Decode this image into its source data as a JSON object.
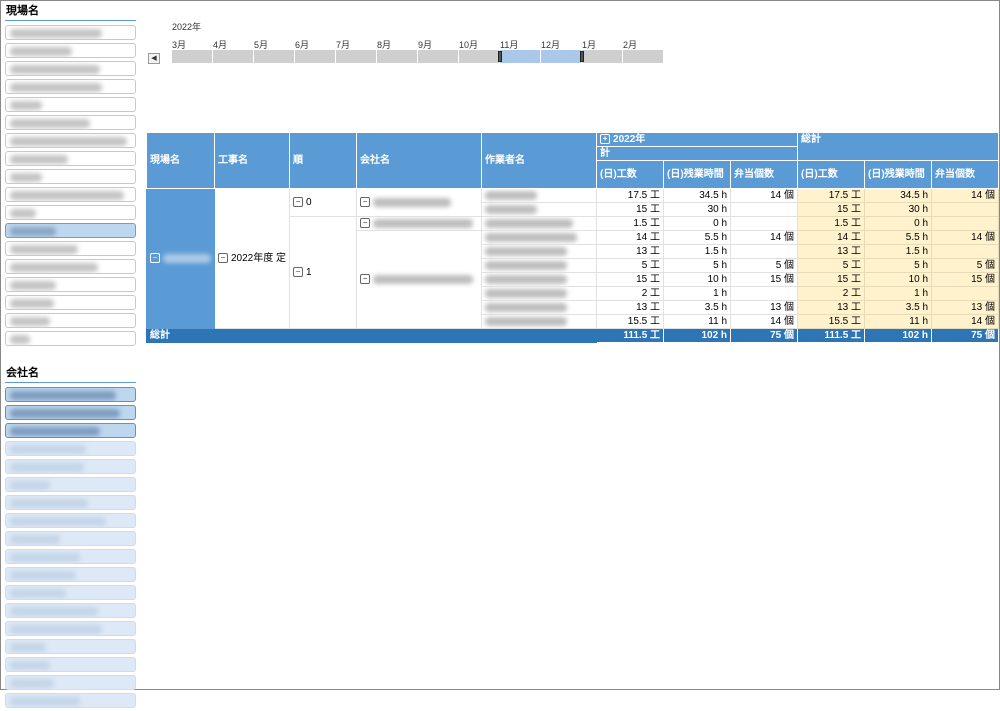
{
  "slicers": {
    "site": {
      "title": "現場名"
    },
    "company": {
      "title": "会社名"
    }
  },
  "timeline": {
    "year": "2022年",
    "months": [
      "3月",
      "4月",
      "5月",
      "6月",
      "7月",
      "8月",
      "9月",
      "10月",
      "11月",
      "12月",
      "1月",
      "2月"
    ],
    "selected_months": [
      "11月",
      "12月"
    ]
  },
  "pivot": {
    "headers": {
      "site": "現場名",
      "work": "工事名",
      "order": "順",
      "company": "会社名",
      "worker": "作業者名",
      "year": "2022年",
      "subtotal": "計",
      "grand": "総計",
      "measures": [
        "(日)工数",
        "(日)残業時間",
        "弁当個数"
      ]
    },
    "work_name": "2022年度 定",
    "groups": [
      "0",
      "1"
    ],
    "rows": [
      {
        "a": "17.5 工",
        "b": "34.5 h",
        "c": "14 個"
      },
      {
        "a": "15 工",
        "b": "30 h",
        "c": ""
      },
      {
        "a": "1.5 工",
        "b": "0 h",
        "c": ""
      },
      {
        "a": "14 工",
        "b": "5.5 h",
        "c": "14 個"
      },
      {
        "a": "13 工",
        "b": "1.5 h",
        "c": ""
      },
      {
        "a": "5 工",
        "b": "5 h",
        "c": "5 個"
      },
      {
        "a": "15 工",
        "b": "10 h",
        "c": "15 個"
      },
      {
        "a": "2 工",
        "b": "1 h",
        "c": ""
      },
      {
        "a": "13 工",
        "b": "3.5 h",
        "c": "13 個"
      },
      {
        "a": "15.5 工",
        "b": "11 h",
        "c": "14 個"
      }
    ],
    "grand_total": {
      "label": "総計",
      "a": "111.5 工",
      "b": "102 h",
      "c": "75 個"
    },
    "colors": {
      "header": "#5b9bd5",
      "grand": "#2e75b6",
      "total_cell": "#fff2cc"
    }
  }
}
